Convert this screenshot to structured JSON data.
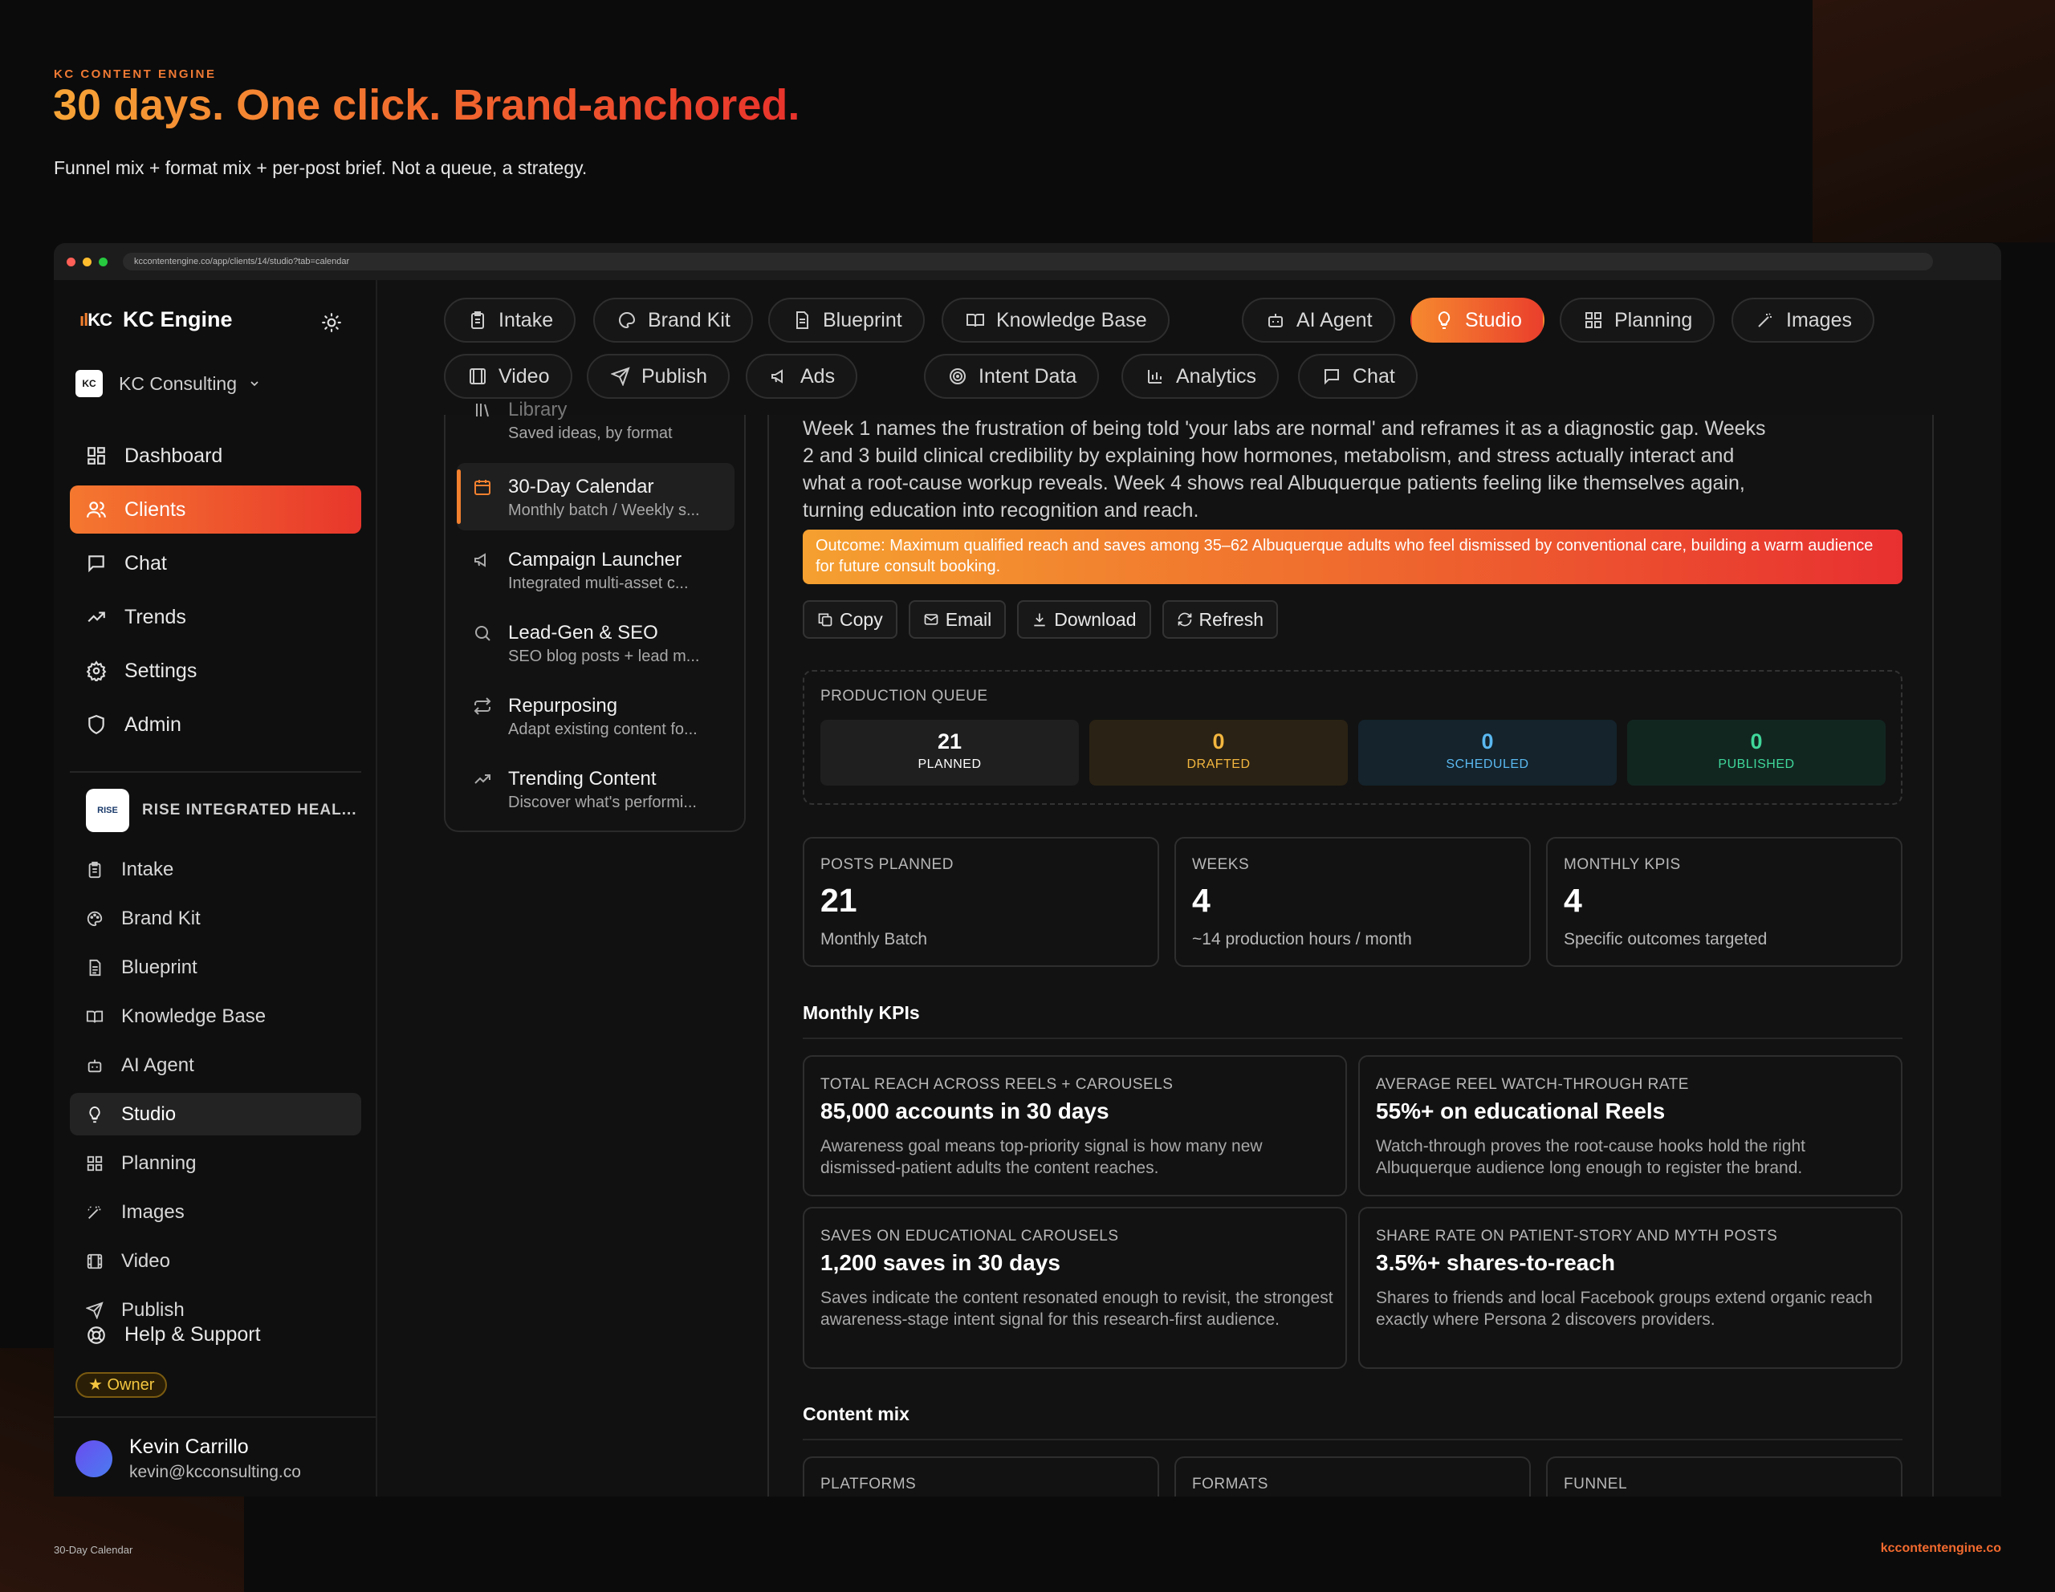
{
  "hero": {
    "eyebrow": "KC CONTENT ENGINE",
    "title": "30 days. One click. Brand-anchored.",
    "subtitle": "Funnel mix + format mix + per-post brief. Not a queue, a strategy."
  },
  "browser": {
    "url": "kccontentengine.co/app/clients/14/studio?tab=calendar"
  },
  "sidebar": {
    "app_name": "KC Engine",
    "logo_text": "KC",
    "client_switcher": {
      "logo": "KC",
      "name": "KC Consulting"
    },
    "nav": [
      {
        "label": "Dashboard",
        "icon": "grid-icon"
      },
      {
        "label": "Clients",
        "icon": "users-icon"
      },
      {
        "label": "Chat",
        "icon": "chat-icon"
      },
      {
        "label": "Trends",
        "icon": "trend-icon"
      },
      {
        "label": "Settings",
        "icon": "gear-icon"
      },
      {
        "label": "Admin",
        "icon": "shield-icon"
      }
    ],
    "client_block": {
      "logo": "RISE",
      "name": "RISE INTEGRATED HEAL...",
      "items": [
        {
          "label": "Intake",
          "icon": "clipboard-icon"
        },
        {
          "label": "Brand Kit",
          "icon": "palette-icon"
        },
        {
          "label": "Blueprint",
          "icon": "document-icon"
        },
        {
          "label": "Knowledge Base",
          "icon": "book-icon"
        },
        {
          "label": "AI Agent",
          "icon": "robot-icon"
        },
        {
          "label": "Studio",
          "icon": "bulb-icon"
        },
        {
          "label": "Planning",
          "icon": "grid-icon"
        },
        {
          "label": "Images",
          "icon": "wand-icon"
        },
        {
          "label": "Video",
          "icon": "film-icon"
        },
        {
          "label": "Publish",
          "icon": "send-icon"
        }
      ]
    },
    "help": "Help & Support",
    "role_badge": "★ Owner",
    "user": {
      "name": "Kevin Carrillo",
      "email": "kevin@kcconsulting.co"
    }
  },
  "tabs": [
    {
      "label": "Intake",
      "icon": "clipboard-icon"
    },
    {
      "label": "Brand Kit",
      "icon": "palette-icon"
    },
    {
      "label": "Blueprint",
      "icon": "document-icon"
    },
    {
      "label": "Knowledge Base",
      "icon": "book-icon"
    },
    {
      "label": "AI Agent",
      "icon": "robot-icon"
    },
    {
      "label": "Studio",
      "icon": "bulb-icon"
    },
    {
      "label": "Planning",
      "icon": "grid-icon"
    },
    {
      "label": "Images",
      "icon": "wand-icon"
    },
    {
      "label": "Video",
      "icon": "film-icon"
    },
    {
      "label": "Publish",
      "icon": "send-icon"
    },
    {
      "label": "Ads",
      "icon": "megaphone-icon"
    },
    {
      "label": "Intent Data",
      "icon": "target-icon"
    },
    {
      "label": "Analytics",
      "icon": "bar-chart-icon"
    },
    {
      "label": "Chat",
      "icon": "chat-icon"
    }
  ],
  "tools": [
    {
      "title": "Library",
      "desc": "Saved ideas, by format",
      "icon": "library-icon"
    },
    {
      "title": "30-Day Calendar",
      "desc": "Monthly batch / Weekly s...",
      "icon": "calendar-icon"
    },
    {
      "title": "Campaign Launcher",
      "desc": "Integrated multi-asset c...",
      "icon": "megaphone-icon"
    },
    {
      "title": "Lead-Gen & SEO",
      "desc": "SEO blog posts + lead m...",
      "icon": "search-icon"
    },
    {
      "title": "Repurposing",
      "desc": "Adapt existing content fo...",
      "icon": "repeat-icon"
    },
    {
      "title": "Trending Content",
      "desc": "Discover what's performi...",
      "icon": "trend-icon"
    }
  ],
  "strategy_text": "Week 1 names the frustration of being told 'your labs are normal' and reframes it as a diagnostic gap. Weeks 2 and 3 build clinical credibility by explaining how hormones, metabolism, and stress actually interact and what a root-cause workup reveals. Week 4 shows real Albuquerque patients feeling like themselves again, turning education into recognition and reach.",
  "outcome": "Outcome: Maximum qualified reach and saves among 35–62 Albuquerque adults who feel dismissed by conventional care, building a warm audience for future consult booking.",
  "actions": [
    "Copy",
    "Email",
    "Download",
    "Refresh"
  ],
  "queue": {
    "label": "PRODUCTION QUEUE",
    "items": [
      {
        "value": "21",
        "label": "PLANNED",
        "color": "#ffffff"
      },
      {
        "value": "0",
        "label": "DRAFTED",
        "color": "#f3b63f"
      },
      {
        "value": "0",
        "label": "SCHEDULED",
        "color": "#5ab8f0"
      },
      {
        "value": "0",
        "label": "PUBLISHED",
        "color": "#3fd79a"
      }
    ]
  },
  "stats": [
    {
      "label": "POSTS PLANNED",
      "value": "21",
      "note": "Monthly Batch"
    },
    {
      "label": "WEEKS",
      "value": "4",
      "note": "~14 production hours / month"
    },
    {
      "label": "MONTHLY KPIS",
      "value": "4",
      "note": "Specific outcomes targeted"
    }
  ],
  "kpi_section": "Monthly KPIs",
  "kpis": [
    {
      "label": "TOTAL REACH ACROSS REELS + CAROUSELS",
      "value": "85,000 accounts in 30 days",
      "desc": "Awareness goal means top-priority signal is how many new dismissed-patient adults the content reaches."
    },
    {
      "label": "AVERAGE REEL WATCH-THROUGH RATE",
      "value": "55%+ on educational Reels",
      "desc": "Watch-through proves the root-cause hooks hold the right Albuquerque audience long enough to register the brand."
    },
    {
      "label": "SAVES ON EDUCATIONAL CAROUSELS",
      "value": "1,200 saves in 30 days",
      "desc": "Saves indicate the content resonated enough to revisit, the strongest awareness-stage intent signal for this research-first audience."
    },
    {
      "label": "SHARE RATE ON PATIENT-STORY AND MYTH POSTS",
      "value": "3.5%+ shares-to-reach",
      "desc": "Shares to friends and local Facebook groups extend organic reach exactly where Persona 2 discovers providers."
    }
  ],
  "mix_section": "Content mix",
  "mix": [
    "PLATFORMS",
    "FORMATS",
    "FUNNEL"
  ],
  "footer": {
    "left": "30-Day Calendar",
    "right": "kccontentengine.co"
  },
  "colors": {
    "accent": "#f2802f",
    "accent_end": "#e8362c",
    "background": "#0b0b0b",
    "panel": "#121212"
  }
}
